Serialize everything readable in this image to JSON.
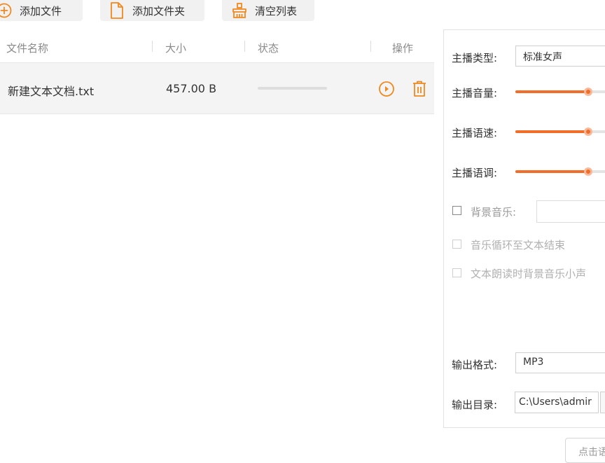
{
  "toolbar": {
    "add_file": "添加文件",
    "add_folder": "添加文件夹",
    "clear_list": "清空列表"
  },
  "list": {
    "headers": {
      "name": "文件名称",
      "size": "大小",
      "status": "状态",
      "actions": "操作"
    },
    "rows": [
      {
        "name": "新建文本文档.txt",
        "size": "457.00 B",
        "progress": 0
      }
    ]
  },
  "settings": {
    "anchor_type_label": "主播类型:",
    "anchor_type_value": "标准女声",
    "volume_label": "主播音量:",
    "volume_level": 0.8,
    "speed_label": "主播语速:",
    "speed_level": 0.8,
    "pitch_label": "主播语调:",
    "pitch_level": 0.8,
    "bgm_label": "背景音乐:",
    "bgm_value": "",
    "loop_label": "音乐循环至文本结束",
    "duck_label": "文本朗读时背景音乐小声",
    "format_label": "输出格式:",
    "format_value": "MP3",
    "dir_label": "输出目录:",
    "dir_value": "C:\\Users\\admir",
    "start_button": "点击语"
  },
  "colors": {
    "accent": "#f06d2a",
    "row_bg": "#f4f4f4"
  }
}
